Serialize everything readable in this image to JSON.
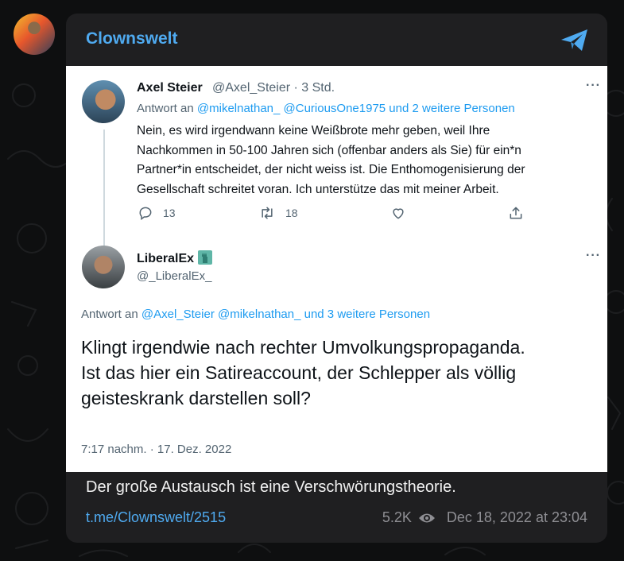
{
  "channel": {
    "name": "Clownswelt",
    "caption": "Der große Austausch ist eine Verschwörungstheorie.",
    "link": "t.me/Clownswelt/2515",
    "views": "5.2K",
    "date": "Dec 18, 2022 at 23:04"
  },
  "icons": {
    "share": "telegram-plane-icon",
    "views": "eye-icon",
    "reply": "reply-icon",
    "retweet": "retweet-icon",
    "like": "heart-icon",
    "share_tweet": "share-upload-icon",
    "more": "more-horizontal-icon",
    "liberty": "statue-of-liberty-emoji"
  },
  "colors": {
    "telegram_accent": "#4faaf0",
    "tweet_link": "#1d9bf0",
    "card_bg": "#1f1f21",
    "page_bg": "#0e0f10"
  },
  "tweet1": {
    "name": "Axel Steier",
    "handle_time": "@Axel_Steier · 3 Std.",
    "more": "···",
    "reply_prefix": "Antwort an",
    "reply_targets": "@mikelnathan_ @CuriousOne1975 und 2 weitere Personen",
    "body_lines": [
      "Nein, es wird irgendwann keine Weißbrote mehr geben, weil Ihre",
      "Nachkommen in 50-100 Jahren sich (offenbar anders als Sie) für ein*n",
      "Partner*in entscheidet, der nicht weiss ist. Die Enthomogenisierung der",
      "Gesellschaft schreitet voran. Ich unterstütze das mit meiner Arbeit."
    ],
    "replies": "13",
    "retweets": "18"
  },
  "tweet2": {
    "name": "LiberalEx",
    "handle": "@_LiberalEx_",
    "more": "···",
    "reply_prefix": "Antwort an",
    "reply_targets": "@Axel_Steier @mikelnathan_ und 3 weitere Personen",
    "body_lines": [
      "Klingt irgendwie nach rechter Umvolkungspropaganda.",
      "Ist das hier ein Satireaccount, der Schlepper als völlig",
      "geisteskrank darstellen soll?"
    ],
    "timestamp": "7:17 nachm. · 17. Dez. 2022"
  }
}
